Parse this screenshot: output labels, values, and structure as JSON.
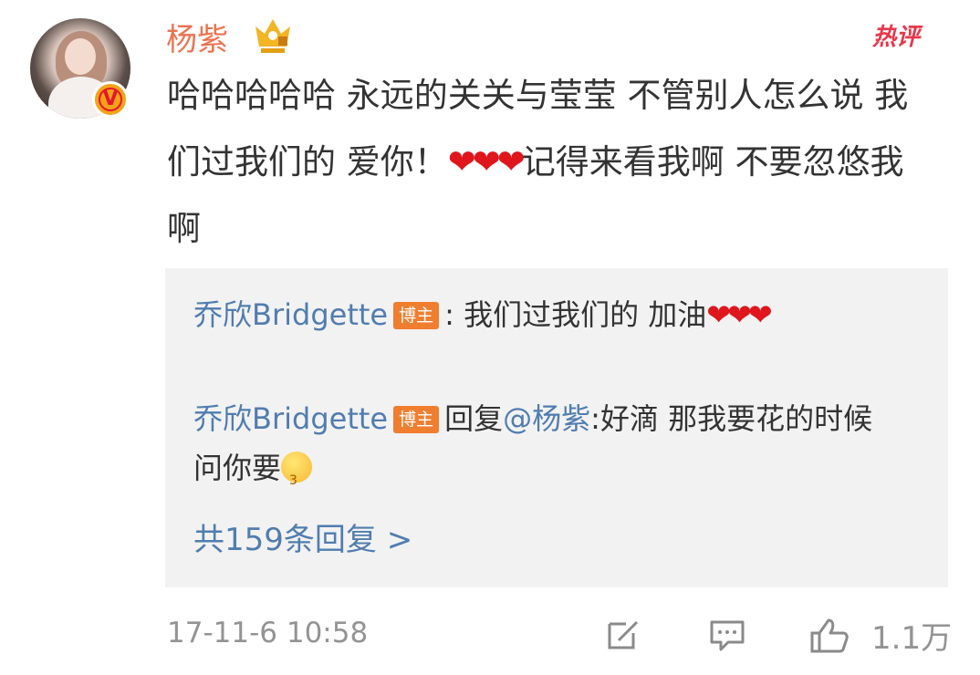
{
  "comment": {
    "username": "杨紫",
    "hot_label": "热评",
    "text_part1": "哈哈哈哈哈 永远的关关与莹莹 不管别人怎么说 我们过我们的 爱你！",
    "hearts": "❤❤❤",
    "text_part2": "记得来看我啊 不要忽悠我啊",
    "verified_badge": "V",
    "timestamp": "17-11-6 10:58",
    "like_count": "1.1万"
  },
  "replies": [
    {
      "author": "乔欣Bridgette",
      "tag": "博主",
      "separator": ":",
      "text": " 我们过我们的 加油",
      "hearts": "❤❤❤"
    },
    {
      "author": "乔欣Bridgette",
      "tag": "博主",
      "prefix": "回复",
      "mention": "@杨紫",
      "text": ":好滴 那我要花的时候 问你要",
      "emoji": "kiss-emoji"
    }
  ],
  "more_replies": "共159条回复 >",
  "icons": [
    "crown-icon",
    "edit-icon",
    "comment-icon",
    "like-icon"
  ],
  "colors": {
    "username": "#eb7350",
    "link": "#507daf",
    "hot": "#e8374a",
    "tag": "#ef7e2f",
    "panel": "#f2f2f2",
    "meta": "#939393"
  }
}
